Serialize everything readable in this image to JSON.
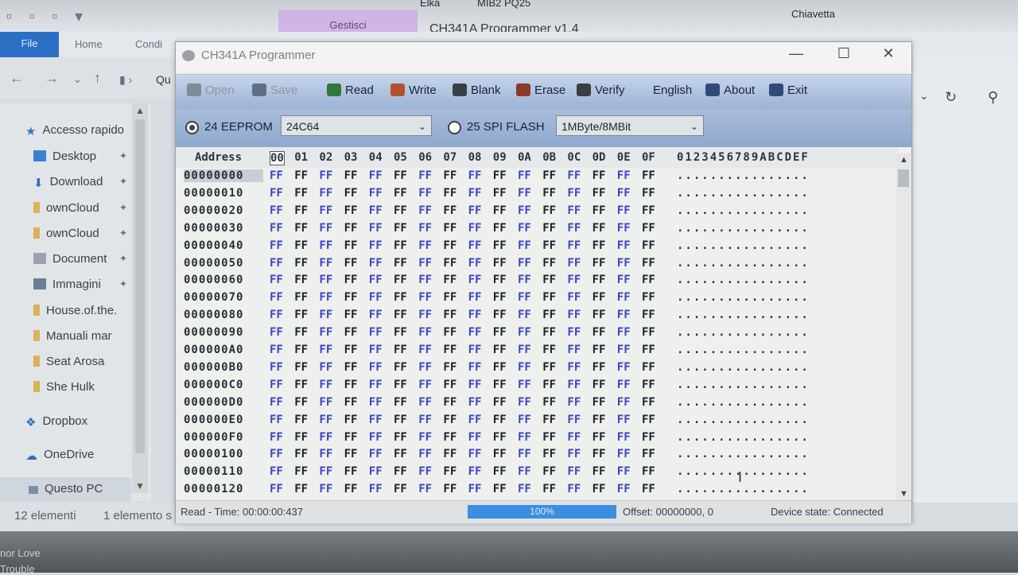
{
  "background": {
    "top_labels": [
      "Gestisci",
      "CH341A Programmer v1.4"
    ],
    "top_trunc": [
      "Elka",
      "MIB2 PQ25",
      "Chiavetta"
    ],
    "ribbon_tabs": [
      "File",
      "Home",
      "Condi"
    ],
    "address_frag": "Qu",
    "sidebar": [
      {
        "label": "Accesso rapido",
        "icon": "star-icon",
        "pin": false
      },
      {
        "label": "Desktop",
        "icon": "desktop-icon",
        "pin": true
      },
      {
        "label": "Download",
        "icon": "download-icon",
        "pin": true
      },
      {
        "label": "ownCloud",
        "icon": "folder-icon",
        "pin": true
      },
      {
        "label": "ownCloud",
        "icon": "folder-icon",
        "pin": true
      },
      {
        "label": "Document",
        "icon": "document-icon",
        "pin": true
      },
      {
        "label": "Immagini",
        "icon": "images-icon",
        "pin": true
      },
      {
        "label": "House.of.the.",
        "icon": "folder-icon",
        "pin": false
      },
      {
        "label": "Manuali mar",
        "icon": "folder-icon",
        "pin": false
      },
      {
        "label": "Seat Arosa",
        "icon": "folder-icon",
        "pin": false
      },
      {
        "label": "She Hulk",
        "icon": "folder-icon",
        "pin": false
      },
      {
        "label": "Dropbox",
        "icon": "dropbox-icon",
        "pin": false
      },
      {
        "label": "OneDrive",
        "icon": "onedrive-icon",
        "pin": false
      },
      {
        "label": "Questo PC",
        "icon": "pc-icon",
        "pin": false
      }
    ],
    "status_count": "12 elementi",
    "status_selected": "1 elemento s",
    "bottom_frags": [
      "nor Love",
      "Trouble"
    ]
  },
  "app": {
    "title": "CH341A Programmer",
    "toolbar": [
      {
        "label": "Open",
        "icon": "open-icon",
        "enabled": false,
        "color": "#7f8b99"
      },
      {
        "label": "Save",
        "icon": "save-icon",
        "enabled": false,
        "color": "#5c6f86"
      },
      {
        "label": "Read",
        "icon": "read-chip-icon",
        "enabled": true,
        "color": "#2f7a3a"
      },
      {
        "label": "Write",
        "icon": "write-chip-icon",
        "enabled": true,
        "color": "#b0532c"
      },
      {
        "label": "Blank",
        "icon": "blank-chip-icon",
        "enabled": true,
        "color": "#3a3f46"
      },
      {
        "label": "Erase",
        "icon": "erase-chip-icon",
        "enabled": true,
        "color": "#8a3a2a"
      },
      {
        "label": "Verify",
        "icon": "verify-chip-icon",
        "enabled": true,
        "color": "#3a3f46"
      },
      {
        "label": "English",
        "icon": "",
        "enabled": true,
        "color": ""
      },
      {
        "label": "About",
        "icon": "info-icon",
        "enabled": true,
        "color": "#2e4b7a"
      },
      {
        "label": "Exit",
        "icon": "exit-icon",
        "enabled": true,
        "color": "#2e4b7a"
      }
    ],
    "options": {
      "eeprom_label": "24 EEPROM",
      "eeprom_selected": true,
      "eeprom_model": "24C64",
      "spi_label": "25 SPI FLASH",
      "spi_selected": false,
      "spi_size": "1MByte/8MBit"
    },
    "hex": {
      "address_header": "Address",
      "columns": [
        "00",
        "01",
        "02",
        "03",
        "04",
        "05",
        "06",
        "07",
        "08",
        "09",
        "0A",
        "0B",
        "0C",
        "0D",
        "0E",
        "0F"
      ],
      "ascii_header": "0123456789ABCDEF",
      "addresses": [
        "00000000",
        "00000010",
        "00000020",
        "00000030",
        "00000040",
        "00000050",
        "00000060",
        "00000070",
        "00000080",
        "00000090",
        "000000A0",
        "000000B0",
        "000000C0",
        "000000D0",
        "000000E0",
        "000000F0",
        "00000100",
        "00000110",
        "00000120"
      ],
      "byte_value": "FF",
      "ascii_value": "................",
      "byte_colors": [
        "#3a46c8",
        "#1c2130"
      ]
    },
    "status": {
      "read_time": "Read - Time: 00:00:00:437",
      "progress": 100,
      "progress_label": "100%",
      "offset": "Offset: 00000000, 0",
      "device_state": "Device state: Connected"
    }
  }
}
